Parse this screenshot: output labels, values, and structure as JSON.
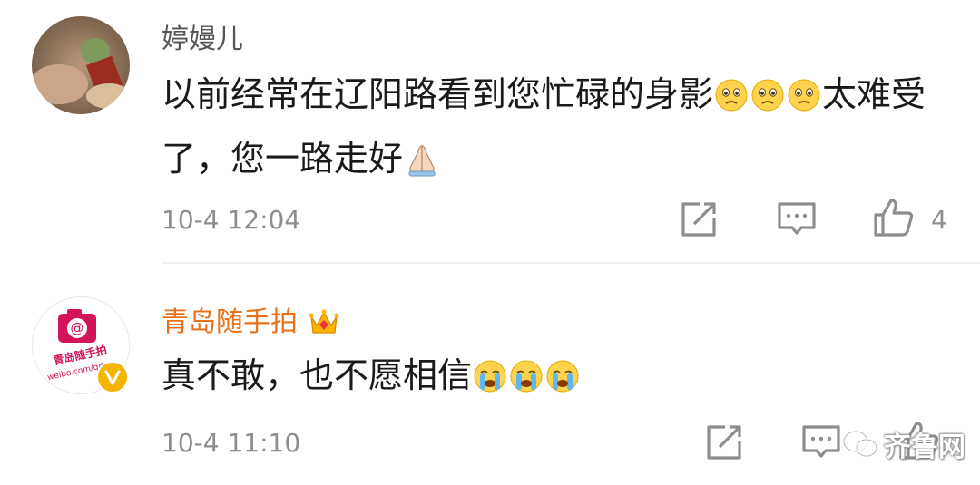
{
  "comments": [
    {
      "username": "婷嫚儿",
      "text_part1": "以前经常在辽阳路看到您忙碌的身影",
      "emoji_after_part1": [
        "sad-face-emoji",
        "sad-face-emoji",
        "sad-face-emoji"
      ],
      "text_part2": "太难受了，您一路走好",
      "emoji_after_part2": [
        "praying-hands-emoji"
      ],
      "time": "10-4 12:04",
      "like_count": "4"
    },
    {
      "username": "青岛随手拍",
      "text_part1": "真不敢，也不愿相信",
      "emoji_after_part1": [
        "crying-face-emoji",
        "crying-face-emoji",
        "crying-face-emoji"
      ],
      "time": "10-4 11:10",
      "avatar": {
        "brand_text": "青岛随手拍",
        "url_text": "weibo.com/qdssp"
      }
    }
  ],
  "watermark": {
    "text": "齐鲁网"
  },
  "colors": {
    "vip_username": "#e8711a",
    "text": "#1a1a1a",
    "meta": "#8d8d8d",
    "verified_badge": "#f5b400",
    "avatar_red": "#d4145a"
  }
}
